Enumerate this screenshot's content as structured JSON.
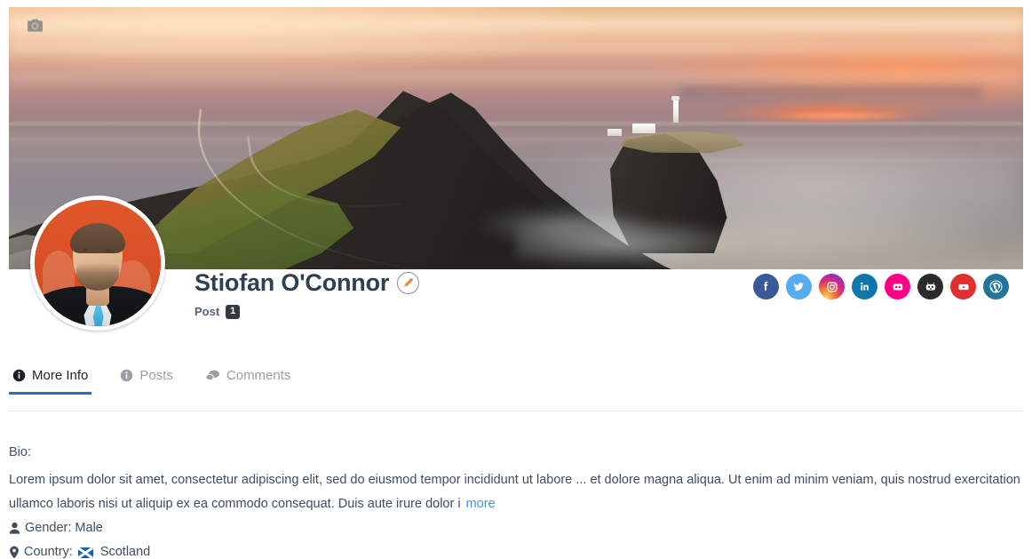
{
  "cover": {
    "camera_icon": "camera-icon",
    "scene": "Neist Point lighthouse cliff at sunset"
  },
  "profile": {
    "name": "Stiofan O'Connor",
    "edit_icon": "pencil-icon",
    "avatar_alt": "profile-photo",
    "post_label": "Post",
    "post_count": "1"
  },
  "socials": [
    {
      "name": "facebook",
      "label": "Facebook",
      "color": "#3b5998"
    },
    {
      "name": "twitter",
      "label": "Twitter",
      "color": "#55acee"
    },
    {
      "name": "instagram",
      "label": "Instagram",
      "color": "#c13584"
    },
    {
      "name": "linkedin",
      "label": "LinkedIn",
      "color": "#0e76a8"
    },
    {
      "name": "flickr",
      "label": "Flickr",
      "color": "#ff0084"
    },
    {
      "name": "github",
      "label": "GitHub",
      "color": "#2b2b2b"
    },
    {
      "name": "youtube",
      "label": "YouTube",
      "color": "#e02f2f"
    },
    {
      "name": "wordpress",
      "label": "WordPress",
      "color": "#21759b"
    }
  ],
  "tabs": [
    {
      "label": "More Info",
      "icon": "info-circle-icon",
      "active": true
    },
    {
      "label": "Posts",
      "icon": "info-circle-icon",
      "active": false
    },
    {
      "label": "Comments",
      "icon": "comments-icon",
      "active": false
    }
  ],
  "bio": {
    "label": "Bio:",
    "text": "Lorem ipsum dolor sit amet, consectetur adipiscing elit, sed do eiusmod tempor incididunt ut labore ... et dolore magna aliqua. Ut enim ad minim veniam, quis nostrud exercitation ullamco laboris nisi ut aliquip ex ea commodo consequat. Duis aute irure dolor i",
    "more_link": "more"
  },
  "details": {
    "gender_icon": "user-icon",
    "gender_label": "Gender: Male",
    "country_icon": "map-marker-icon",
    "country_label": "Country:",
    "country_flag": "scotland-flag-icon",
    "country_value": "Scotland"
  },
  "theme": {
    "accent": "#2b6cb8",
    "name_color": "#2f4052",
    "link_color": "#4a90d9",
    "muted": "#9aa0a6"
  }
}
